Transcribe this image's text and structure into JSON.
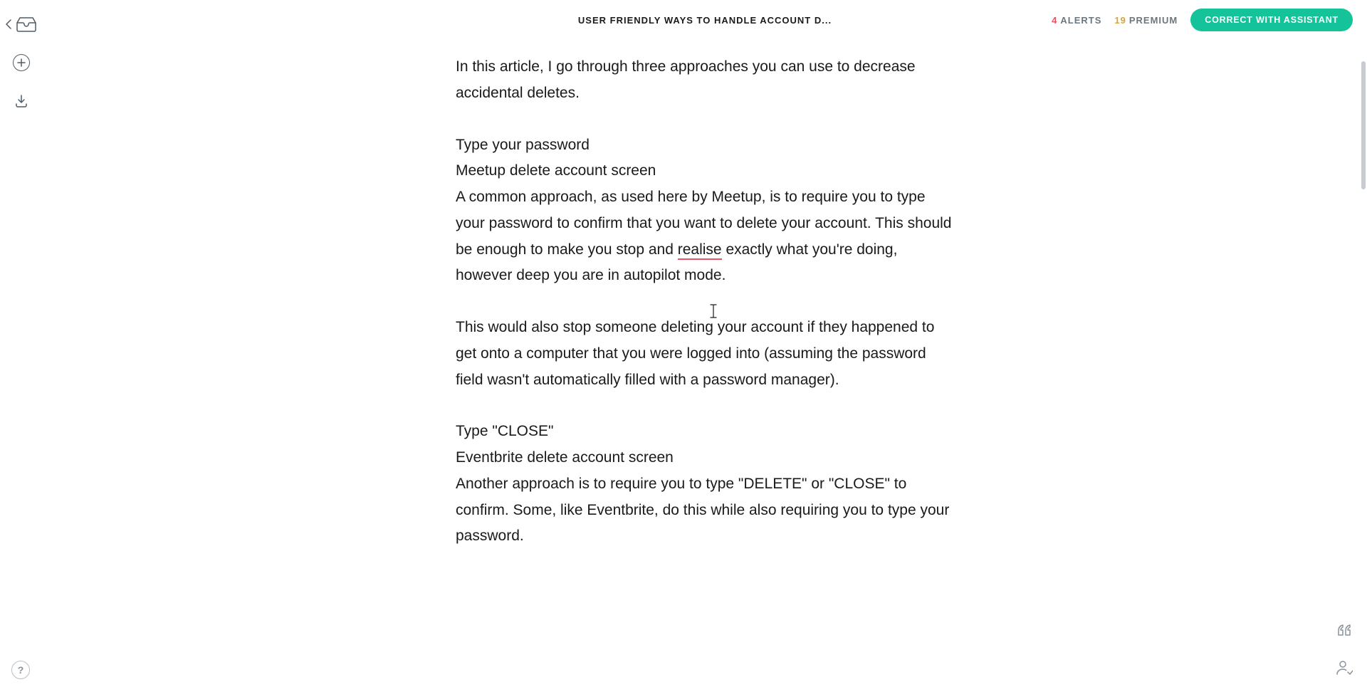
{
  "header": {
    "title": "USER FRIENDLY WAYS TO HANDLE ACCOUNT D...",
    "alerts_count": "4",
    "alerts_label": "ALERTS",
    "premium_count": "19",
    "premium_label": "PREMIUM",
    "assistant_button": "CORRECT WITH ASSISTANT"
  },
  "sidebar": {
    "help_label": "?"
  },
  "document": {
    "p1": "In this article, I go through three approaches you can use to decrease accidental deletes.",
    "p2_l1": "Type your password",
    "p2_l2": "Meetup delete account screen",
    "p2_l3a": "A common approach, as used here by Meetup, is to require you to type your password to confirm that you want to delete your account. This should be enough to make you stop and ",
    "p2_err": "realise",
    "p2_l3b": " exactly what you're doing, however deep you are in autopilot mode.",
    "p3": "This would also stop someone deleting your account if they happened to get onto a computer that you were logged into (assuming the password field wasn't automatically filled with a password manager).",
    "p4_l1": "Type \"CLOSE\"",
    "p4_l2": "Eventbrite delete account screen",
    "p4_l3": "Another approach is to require you to type \"DELETE\" or \"CLOSE\" to confirm. Some, like Eventbrite, do this while also requiring you to type your password."
  }
}
